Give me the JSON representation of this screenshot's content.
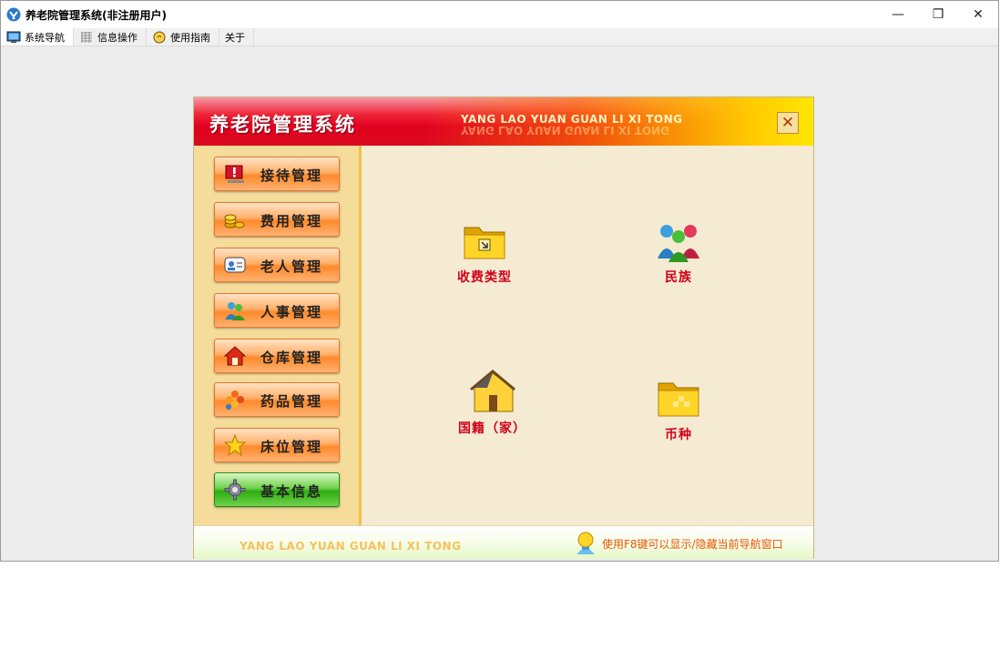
{
  "window": {
    "title": "养老院管理系统(非注册用户)",
    "controls": {
      "minimize": "—",
      "maximize": "❐",
      "close": "✕"
    }
  },
  "menubar": {
    "items": [
      {
        "label": "系统导航",
        "icon": "monitor-icon"
      },
      {
        "label": "信息操作",
        "icon": "grid-icon"
      },
      {
        "label": "使用指南",
        "icon": "lightbulb-icon"
      },
      {
        "label": "关于",
        "icon": ""
      }
    ]
  },
  "dialog": {
    "title": "养老院管理系统",
    "subtitle": "YANG LAO YUAN GUAN LI XI TONG",
    "close_label": "✕",
    "sidebar": [
      {
        "label": "接待管理",
        "icon": "alert-monitor-icon"
      },
      {
        "label": "费用管理",
        "icon": "coins-icon"
      },
      {
        "label": "老人管理",
        "icon": "id-card-icon"
      },
      {
        "label": "人事管理",
        "icon": "people-icon"
      },
      {
        "label": "仓库管理",
        "icon": "house-icon"
      },
      {
        "label": "药品管理",
        "icon": "herb-icon"
      },
      {
        "label": "床位管理",
        "icon": "star-icon"
      },
      {
        "label": "基本信息",
        "icon": "gear-icon",
        "active": true
      }
    ],
    "content": [
      {
        "label": "收费类型",
        "icon": "folder-arrow-icon"
      },
      {
        "label": "民族",
        "icon": "users-group-icon"
      },
      {
        "label": "国籍（家）",
        "icon": "house-icon"
      },
      {
        "label": "币种",
        "icon": "folder-icon"
      }
    ],
    "footer": {
      "subtitle": "YANG LAO YUAN GUAN LI XI TONG",
      "tip": "使用F8键可以显示/隐藏当前导航窗口"
    }
  },
  "colors": {
    "accent_red": "#d0011b",
    "header_red": "#e1001f",
    "header_yellow": "#ffe600",
    "sidebar_bg": "#f5dc9b",
    "content_bg": "#f5ebd3",
    "button_orange": "#ff8a2a",
    "button_green": "#2fae12",
    "tip_orange": "#e8560a"
  }
}
